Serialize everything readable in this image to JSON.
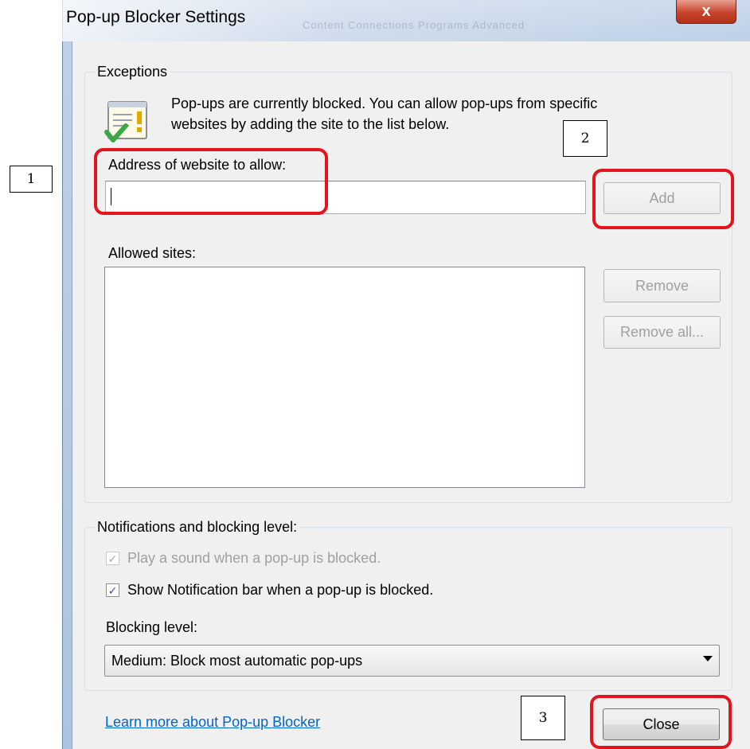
{
  "window": {
    "title": "Pop-up Blocker Settings",
    "close_label": "x",
    "ghost_text": "Content   Connections   Programs   Advanced"
  },
  "exceptions": {
    "legend": "Exceptions",
    "info_line1": "Pop-ups are currently blocked.  You can allow pop-ups from specific",
    "info_line2": "websites by adding the site to the list below.",
    "address_label": "Address of website to allow:",
    "address_value": "",
    "add_button": "Add",
    "allowed_label": "Allowed sites:",
    "allowed_sites": [],
    "remove_button": "Remove",
    "remove_all_button": "Remove all..."
  },
  "notifications": {
    "legend": "Notifications and blocking level:",
    "play_sound": {
      "label": "Play a sound when a pop-up is blocked.",
      "checked": true,
      "enabled": false
    },
    "show_bar": {
      "label": "Show Notification bar when a pop-up is blocked.",
      "checked": true,
      "enabled": true
    },
    "blocking_label": "Blocking level:",
    "blocking_value": "Medium: Block most automatic pop-ups"
  },
  "footer": {
    "learn_more_link": "Learn more about Pop-up Blocker",
    "close_button": "Close"
  },
  "annotations": [
    "1",
    "2",
    "3"
  ],
  "colors": {
    "highlight": "#e3141e",
    "link": "#0066cc",
    "dialog_bg": "#f0f0f0",
    "titlebar": "#bfd0e6"
  }
}
